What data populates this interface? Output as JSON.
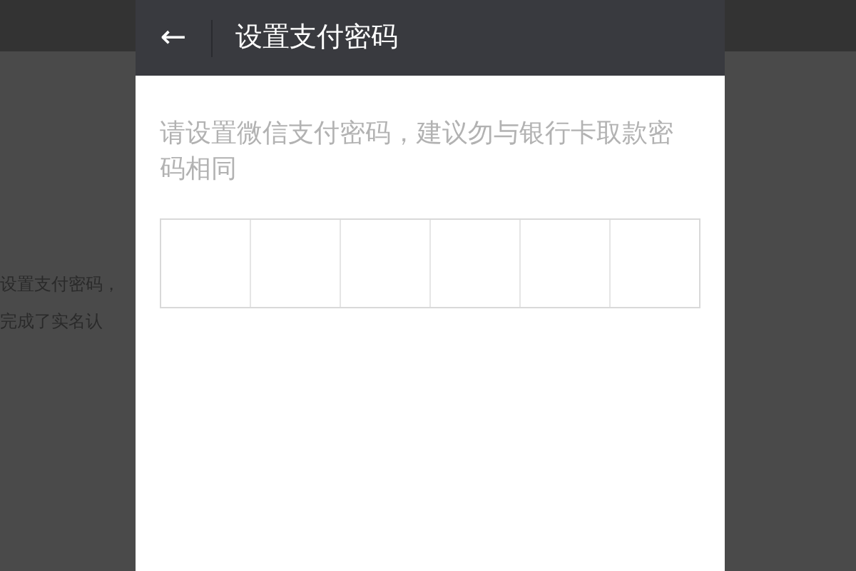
{
  "background": {
    "lines": [
      "设置支付密码，",
      "完成了实名认"
    ]
  },
  "dialog": {
    "title": "设置支付密码",
    "back_icon": "←",
    "prompt": "请设置微信支付密码，建议勿与银行卡取款密码相同"
  }
}
